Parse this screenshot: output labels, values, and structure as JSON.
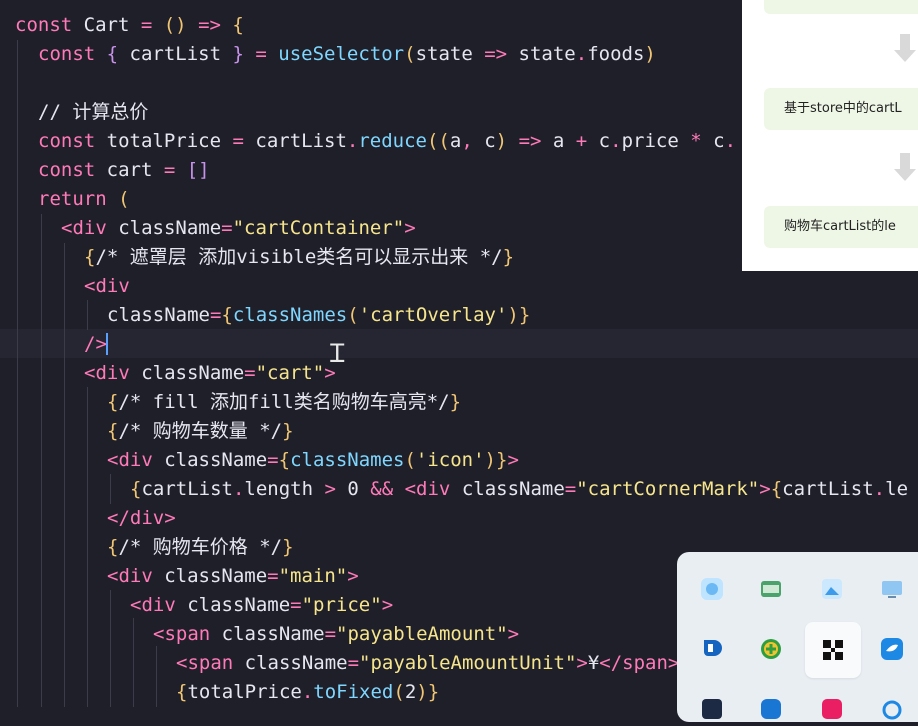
{
  "code_lines": [
    {
      "tokens": [
        [
          "kw",
          "const "
        ],
        [
          "id",
          "Cart "
        ],
        [
          "punc",
          "= "
        ],
        [
          "brk",
          "()"
        ],
        [
          "punc",
          " => "
        ],
        [
          "brk",
          "{"
        ]
      ]
    },
    {
      "tokens": [
        [
          "kw",
          "const "
        ],
        [
          "bracket2",
          "{ "
        ],
        [
          "id",
          "cartList "
        ],
        [
          "bracket2",
          "} "
        ],
        [
          "punc",
          "= "
        ],
        [
          "fn",
          "useSelector"
        ],
        [
          "brk",
          "("
        ],
        [
          "id",
          "state "
        ],
        [
          "punc",
          "=> "
        ],
        [
          "id",
          "state"
        ],
        [
          "punc",
          "."
        ],
        [
          "id",
          "foods"
        ],
        [
          "brk",
          ")"
        ]
      ]
    },
    {
      "tokens": []
    },
    {
      "tokens": [
        [
          "cmt",
          "// 计算总价"
        ]
      ]
    },
    {
      "tokens": [
        [
          "kw",
          "const "
        ],
        [
          "id",
          "totalPrice "
        ],
        [
          "punc",
          "= "
        ],
        [
          "id",
          "cartList"
        ],
        [
          "punc",
          "."
        ],
        [
          "fn",
          "reduce"
        ],
        [
          "brk",
          "(("
        ],
        [
          "id",
          "a"
        ],
        [
          "punc",
          ", "
        ],
        [
          "id",
          "c"
        ],
        [
          "brk",
          ")"
        ],
        [
          "punc",
          " => "
        ],
        [
          "id",
          "a "
        ],
        [
          "punc",
          "+ "
        ],
        [
          "id",
          "c"
        ],
        [
          "punc",
          "."
        ],
        [
          "id",
          "price "
        ],
        [
          "punc",
          "* "
        ],
        [
          "id",
          "c"
        ],
        [
          "punc",
          "."
        ]
      ]
    },
    {
      "tokens": [
        [
          "kw",
          "const "
        ],
        [
          "id",
          "cart "
        ],
        [
          "punc",
          "= "
        ],
        [
          "bracket2",
          "[]"
        ]
      ]
    },
    {
      "tokens": [
        [
          "kw",
          "return "
        ],
        [
          "brk",
          "("
        ]
      ]
    },
    {
      "tokens": [
        [
          "tag",
          "<div "
        ],
        [
          "attr",
          "className"
        ],
        [
          "punc",
          "="
        ],
        [
          "str",
          "\"cartContainer\""
        ],
        [
          "tag",
          ">"
        ]
      ]
    },
    {
      "tokens": [
        [
          "brk",
          "{"
        ],
        [
          "cmt",
          "/* 遮罩层 添加visible类名可以显示出来 */"
        ],
        [
          "brk",
          "}"
        ]
      ]
    },
    {
      "tokens": [
        [
          "tag",
          "<div"
        ]
      ]
    },
    {
      "tokens": [
        [
          "attr",
          "className"
        ],
        [
          "punc",
          "="
        ],
        [
          "brk",
          "{"
        ],
        [
          "fn",
          "classNames"
        ],
        [
          "brk",
          "("
        ],
        [
          "str",
          "'cartOverlay'"
        ],
        [
          "brk",
          ")}"
        ]
      ]
    },
    {
      "tokens": [
        [
          "tag",
          "/>"
        ]
      ]
    },
    {
      "tokens": [
        [
          "tag",
          "<div "
        ],
        [
          "attr",
          "className"
        ],
        [
          "punc",
          "="
        ],
        [
          "str",
          "\"cart\""
        ],
        [
          "tag",
          ">"
        ]
      ]
    },
    {
      "tokens": [
        [
          "brk",
          "{"
        ],
        [
          "cmt",
          "/* fill 添加fill类名购物车高亮*/"
        ],
        [
          "brk",
          "}"
        ]
      ]
    },
    {
      "tokens": [
        [
          "brk",
          "{"
        ],
        [
          "cmt",
          "/* 购物车数量 */"
        ],
        [
          "brk",
          "}"
        ]
      ]
    },
    {
      "tokens": [
        [
          "tag",
          "<div "
        ],
        [
          "attr",
          "className"
        ],
        [
          "punc",
          "="
        ],
        [
          "brk",
          "{"
        ],
        [
          "fn",
          "classNames"
        ],
        [
          "brk",
          "("
        ],
        [
          "str",
          "'icon'"
        ],
        [
          "brk",
          ")}"
        ],
        [
          "tag",
          ">"
        ]
      ]
    },
    {
      "tokens": [
        [
          "brk",
          "{"
        ],
        [
          "id",
          "cartList"
        ],
        [
          "punc",
          "."
        ],
        [
          "id",
          "length "
        ],
        [
          "punc",
          "> "
        ],
        [
          "id",
          "0 "
        ],
        [
          "punc",
          "&& "
        ],
        [
          "tag",
          "<div "
        ],
        [
          "attr",
          "className"
        ],
        [
          "punc",
          "="
        ],
        [
          "str",
          "\"cartCornerMark\""
        ],
        [
          "tag",
          ">"
        ],
        [
          "brk",
          "{"
        ],
        [
          "id",
          "cartList"
        ],
        [
          "punc",
          "."
        ],
        [
          "id",
          "le"
        ]
      ]
    },
    {
      "tokens": [
        [
          "tag",
          "</div>"
        ]
      ]
    },
    {
      "tokens": [
        [
          "brk",
          "{"
        ],
        [
          "cmt",
          "/* 购物车价格 */"
        ],
        [
          "brk",
          "}"
        ]
      ]
    },
    {
      "tokens": [
        [
          "tag",
          "<div "
        ],
        [
          "attr",
          "className"
        ],
        [
          "punc",
          "="
        ],
        [
          "str",
          "\"main\""
        ],
        [
          "tag",
          ">"
        ]
      ]
    },
    {
      "tokens": [
        [
          "tag",
          "<div "
        ],
        [
          "attr",
          "className"
        ],
        [
          "punc",
          "="
        ],
        [
          "str",
          "\"price\""
        ],
        [
          "tag",
          ">"
        ]
      ]
    },
    {
      "tokens": [
        [
          "tag",
          "<span "
        ],
        [
          "attr",
          "className"
        ],
        [
          "punc",
          "="
        ],
        [
          "str",
          "\"payableAmount\""
        ],
        [
          "tag",
          ">"
        ]
      ]
    },
    {
      "tokens": [
        [
          "tag",
          "<span "
        ],
        [
          "attr",
          "className"
        ],
        [
          "punc",
          "="
        ],
        [
          "str",
          "\"payableAmountUnit\""
        ],
        [
          "tag",
          ">"
        ],
        [
          "id",
          "¥"
        ],
        [
          "tag",
          "</span>"
        ]
      ]
    },
    {
      "tokens": [
        [
          "brk",
          "{"
        ],
        [
          "id",
          "totalPrice"
        ],
        [
          "punc",
          "."
        ],
        [
          "fn",
          "toFixed"
        ],
        [
          "brk",
          "("
        ],
        [
          "id",
          "2"
        ],
        [
          "brk",
          ")}"
        ]
      ]
    }
  ],
  "flowchart": {
    "box_store": "基于store中的cartL",
    "box_cartlist": "购物车cartList的le"
  },
  "taskbar": {
    "icons": [
      "finder-icon",
      "files-icon",
      "photo-tool-icon",
      "remote-desktop-icon",
      "edge-icon",
      "add-app-icon",
      "app-grid-icon",
      "feishu-icon",
      "app-icon-4",
      "app-icon-5",
      "media-icon",
      "bug-icon"
    ]
  },
  "colors": {
    "editor_bg": "#1f1f29",
    "keyword": "#ff7ab8",
    "function": "#7fd7ff",
    "string": "#f6e58d",
    "flow_box": "#eef7e6"
  }
}
